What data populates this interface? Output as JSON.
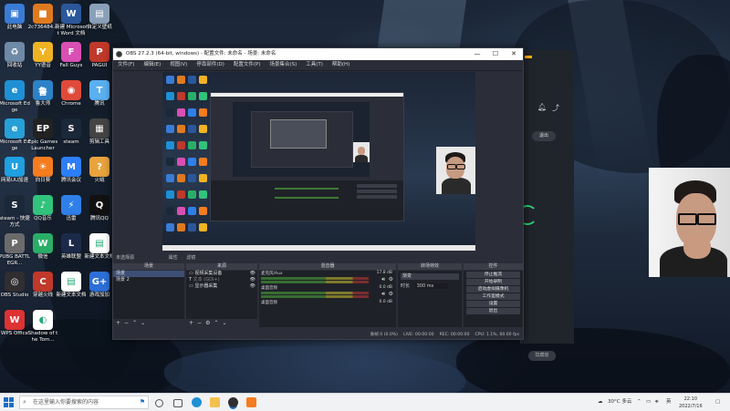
{
  "desktop": {
    "icons": [
      {
        "label": "此电脑",
        "color": "#3a7bd5",
        "symbol": "▣"
      },
      {
        "label": "2c736484...",
        "color": "#e07a1f",
        "symbol": "■"
      },
      {
        "label": "新建 Microsoft Word 文档",
        "color": "#2b579a",
        "symbol": "W"
      },
      {
        "label": "自定义壁纸",
        "color": "#8aa0b8",
        "symbol": "▤"
      },
      {
        "label": "回收站",
        "color": "#6e8aa6",
        "symbol": "♻"
      },
      {
        "label": "YY语音",
        "color": "#f0b323",
        "symbol": "Y"
      },
      {
        "label": "Fall Guys",
        "color": "#d94fb3",
        "symbol": "F"
      },
      {
        "label": "PAGUI",
        "color": "#c0392b",
        "symbol": "P"
      },
      {
        "label": "Microsoft Edge",
        "color": "#1e90d6",
        "symbol": "e"
      },
      {
        "label": "鲁大师",
        "color": "#2c82c9",
        "symbol": "鲁"
      },
      {
        "label": "Chrome",
        "color": "#e04a3a",
        "symbol": "◉"
      },
      {
        "label": "腾讯",
        "color": "#5ab0f0",
        "symbol": "T"
      },
      {
        "label": "Microsoft Edge",
        "color": "#27a0d8",
        "symbol": "e"
      },
      {
        "label": "Epic Games Launcher",
        "color": "#222222",
        "symbol": "EP"
      },
      {
        "label": "steam",
        "color": "#1b2838",
        "symbol": "S"
      },
      {
        "label": "剪辑工具",
        "color": "#444444",
        "symbol": "▦"
      },
      {
        "label": "网易UU加速",
        "color": "#1fa0e0",
        "symbol": "U"
      },
      {
        "label": "向日葵",
        "color": "#f57c1f",
        "symbol": "☀"
      },
      {
        "label": "腾讯会议",
        "color": "#2d7ff9",
        "symbol": "M"
      },
      {
        "label": "火绒",
        "color": "#e8a33d",
        "symbol": "?"
      },
      {
        "label": "steam - 快捷方式",
        "color": "#1b2838",
        "symbol": "S"
      },
      {
        "label": "QQ音乐",
        "color": "#31c27c",
        "symbol": "♪"
      },
      {
        "label": "迅雷",
        "color": "#2f7fe8",
        "symbol": "⚡"
      },
      {
        "label": "腾讯QQ",
        "color": "#111111",
        "symbol": "Q"
      },
      {
        "label": "PUBG BATTLEGR...",
        "color": "#6b6b6b",
        "symbol": "P"
      },
      {
        "label": "微信",
        "color": "#2aae67",
        "symbol": "W"
      },
      {
        "label": "英雄联盟",
        "color": "#1c2a4a",
        "symbol": "L"
      },
      {
        "label": "新建文本文档",
        "color": "#ffffff",
        "symbol": "▤"
      },
      {
        "label": "OBS Studio",
        "color": "#302e31",
        "symbol": "◎"
      },
      {
        "label": "穿越火线",
        "color": "#c0392b",
        "symbol": "C"
      },
      {
        "label": "新建文本文档",
        "color": "#ffffff",
        "symbol": "▤"
      },
      {
        "label": "游戏加加",
        "color": "#2c6fd6",
        "symbol": "G+"
      },
      {
        "label": "WPS Office",
        "color": "#d33",
        "symbol": "W"
      },
      {
        "label": "Shadow of the Tom...",
        "color": "#ffffff",
        "symbol": "◐"
      }
    ]
  },
  "obs": {
    "title": "OBS 27.2.3 (64-bit, windows) - 配置文件: 未命名 - 场景: 未命名",
    "menu": [
      "文件(F)",
      "编辑(E)",
      "视图(V)",
      "停靠部件(D)",
      "配置文件(P)",
      "场景集合(S)",
      "工具(T)",
      "帮助(H)"
    ],
    "source_toolbar": [
      "未选择源",
      "属性",
      "滤镜"
    ],
    "docks": {
      "scenes": {
        "title": "场景",
        "items": [
          "场景",
          "场景 2"
        ]
      },
      "sources": {
        "title": "来源",
        "items": [
          "视频采集设备",
          "文本 (GDI+)",
          "显示器采集"
        ]
      },
      "mixer": {
        "title": "混音器",
        "channels": [
          {
            "name": "麦克风/Aux",
            "db": "17.8 dB"
          },
          {
            "name": "桌面音频",
            "db": "0.0 dB"
          },
          {
            "name": "桌面音频",
            "db": "0.0 dB"
          }
        ]
      },
      "transitions": {
        "title": "转场特效",
        "type": "渐变",
        "duration_label": "时长",
        "duration": "300 ms"
      },
      "controls": {
        "title": "控件",
        "buttons": [
          "停止推流",
          "开始录制",
          "启动虚拟摄像机",
          "工作室模式",
          "设置",
          "退出"
        ]
      }
    },
    "status": {
      "dropped": "丢帧 0 (0.0%)",
      "live": "LIVE: 00:00:00",
      "rec": "REC: 00:00:00",
      "cpu": "CPU: 1.1%, 60.00 fps"
    }
  },
  "background_app": {
    "button": "退出",
    "button2": "隐藏窗"
  },
  "taskbar": {
    "search_placeholder": "在这里输入你要搜索的内容",
    "weather": "30°C 多云",
    "time": "22:10",
    "date": "2022/7/16",
    "lang": "英"
  }
}
